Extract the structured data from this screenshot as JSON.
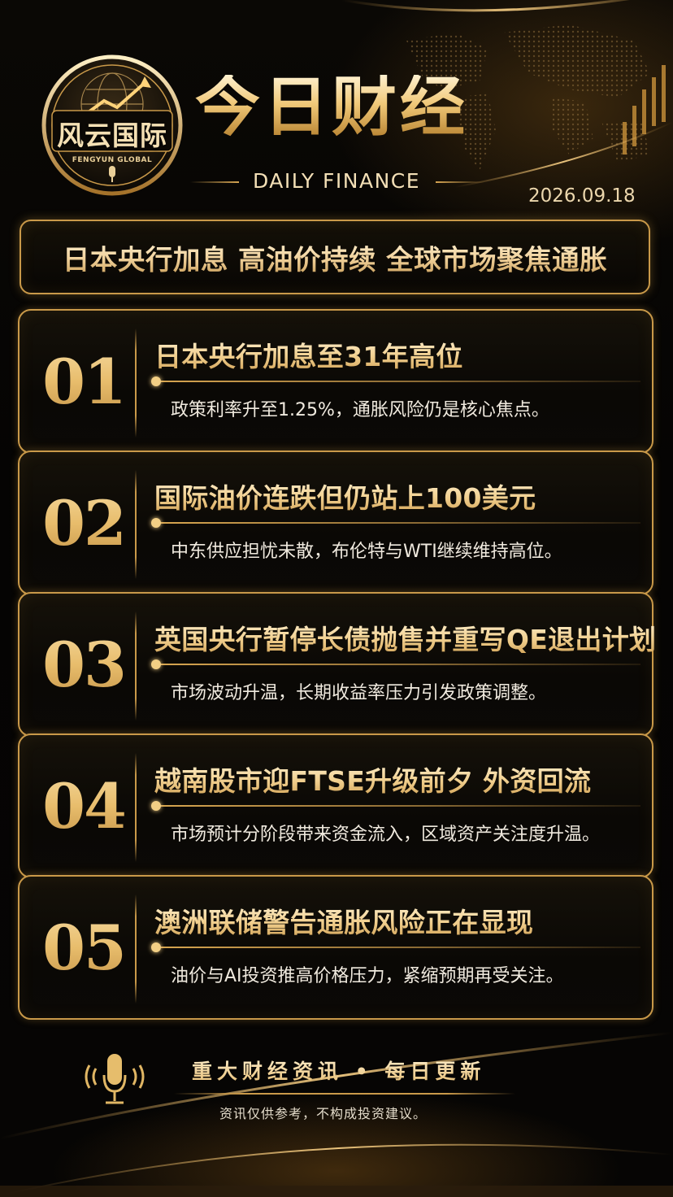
{
  "brand": {
    "logo_text": "风云国际",
    "logo_subtext": "FENGYUN GLOBAL"
  },
  "header": {
    "title": "今日财经",
    "subtitle": "DAILY FINANCE",
    "date": "2026.09.18"
  },
  "banner": {
    "headline": "日本央行加息 高油价持续 全球市场聚焦通胀"
  },
  "news": [
    {
      "number": "01",
      "title": "日本央行加息至31年高位",
      "desc": "政策利率升至1.25%，通胀风险仍是核心焦点。"
    },
    {
      "number": "02",
      "title": "国际油价连跌但仍站上100美元",
      "desc": "中东供应担忧未散，布伦特与WTI继续维持高位。"
    },
    {
      "number": "03",
      "title": "英国央行暂停长债抛售并重写QE退出计划",
      "desc": "市场波动升温，长期收益率压力引发政策调整。"
    },
    {
      "number": "04",
      "title": "越南股市迎FTSE升级前夕 外资回流",
      "desc": "市场预计分阶段带来资金流入，区域资产关注度升温。"
    },
    {
      "number": "05",
      "title": "澳洲联储警告通胀风险正在显现",
      "desc": "油价与AI投资推高价格压力，紧缩预期再受关注。"
    }
  ],
  "footer": {
    "tagline": "重大财经资讯 • 每日更新",
    "disclaimer": "资讯仅供参考，不构成投资建议。"
  },
  "colors": {
    "gold": "#c99949",
    "gold_light": "#f3cf85",
    "background": "#050403"
  },
  "icons": [
    "globe-icon",
    "trend-arrow-icon",
    "microphone-icon"
  ]
}
